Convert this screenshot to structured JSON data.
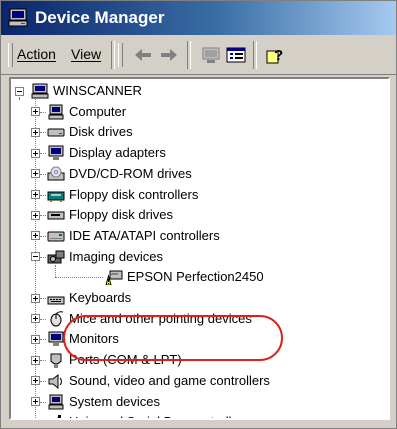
{
  "window": {
    "title": "Device Manager"
  },
  "menu": {
    "action_label": "Action",
    "view_label": "View"
  },
  "toolbar": {
    "icons": [
      "back-arrow-icon",
      "forward-arrow-icon",
      "computer-properties-icon",
      "details-view-icon",
      "help-icon"
    ]
  },
  "tree": {
    "root": "WINSCANNER",
    "categories": [
      {
        "label": "Computer",
        "icon": "computer-icon"
      },
      {
        "label": "Disk drives",
        "icon": "disk-drive-icon"
      },
      {
        "label": "Display adapters",
        "icon": "monitor-icon"
      },
      {
        "label": "DVD/CD-ROM drives",
        "icon": "cd-drive-icon"
      },
      {
        "label": "Floppy disk controllers",
        "icon": "floppy-controller-icon"
      },
      {
        "label": "Floppy disk drives",
        "icon": "floppy-drive-icon"
      },
      {
        "label": "IDE ATA/ATAPI controllers",
        "icon": "ide-controller-icon"
      },
      {
        "label": "Imaging devices",
        "icon": "camera-icon",
        "expanded": true
      },
      {
        "label": "Keyboards",
        "icon": "keyboard-icon"
      },
      {
        "label": "Mice and other pointing devices",
        "icon": "mouse-icon"
      },
      {
        "label": "Monitors",
        "icon": "monitor-icon"
      },
      {
        "label": "Ports (COM & LPT)",
        "icon": "port-icon"
      },
      {
        "label": "Sound, video and game controllers",
        "icon": "speaker-icon"
      },
      {
        "label": "System devices",
        "icon": "computer-icon"
      },
      {
        "label": "Universal Serial Bus controllers",
        "icon": "usb-icon"
      }
    ],
    "imaging_child": {
      "label": "EPSON Perfection2450",
      "icon": "warning-scanner-icon"
    }
  },
  "colors": {
    "highlight": "#e0201a",
    "title_bar": "#0a246a",
    "chrome": "#d4d0c8"
  }
}
